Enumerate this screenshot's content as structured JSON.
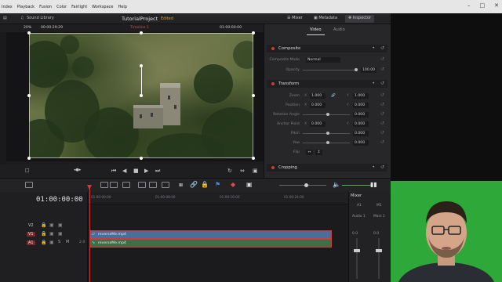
{
  "menubar": {
    "items": [
      "Index",
      "Playback",
      "Fusion",
      "Color",
      "Fairlight",
      "Workspace",
      "Help"
    ]
  },
  "toolbar": {
    "sound_library": "Sound Library",
    "project_title": "TutorialProject",
    "project_status": "Edited",
    "mixer": "Mixer",
    "metadata": "Metadata",
    "inspector": "Inspector"
  },
  "viewer": {
    "zoom": "20%",
    "timecode_left": "00:00:29:29",
    "timeline_name": "Timeline 1",
    "timecode_right": "01:00:00:00"
  },
  "inspector": {
    "tabs": {
      "video": "Video",
      "audio": "Audio"
    },
    "composite": {
      "title": "Composite",
      "mode_label": "Composite Mode",
      "mode_value": "Normal",
      "opacity_label": "Opacity",
      "opacity_value": "100.00"
    },
    "transform": {
      "title": "Transform",
      "zoom_label": "Zoom",
      "zoom_x": "1.000",
      "zoom_y": "1.000",
      "position_label": "Position",
      "position_x": "0.000",
      "position_y": "0.000",
      "rotation_label": "Rotation Angle",
      "rotation_value": "0.000",
      "anchor_label": "Anchor Point",
      "anchor_x": "0.000",
      "anchor_y": "0.000",
      "pitch_label": "Pitch",
      "pitch_value": "0.000",
      "yaw_label": "Yaw",
      "yaw_value": "0.000",
      "flip_label": "Flip",
      "x_axis": "X",
      "y_axis": "Y"
    },
    "cropping": {
      "title": "Cropping"
    }
  },
  "timeline": {
    "timecode": "01:00:00:00",
    "ruler": [
      "01:00:00:00",
      "01:00:08:00",
      "01:00:16:00",
      "01:00:24:00"
    ],
    "tracks": [
      {
        "name": "V2",
        "type": "video"
      },
      {
        "name": "V1",
        "type": "video"
      },
      {
        "name": "A1",
        "type": "audio",
        "level": "2.0"
      }
    ],
    "clips": {
      "video": "reverseMe.mp4",
      "audio": "reverseMe.mp4"
    }
  },
  "mixer": {
    "title": "Mixer",
    "channels": [
      "A1",
      "M1"
    ],
    "buses": [
      "Audio 1",
      "Main 1"
    ],
    "level": "0.0",
    "ch_a1": "A1",
    "ch_m1": "M1"
  },
  "colors": {
    "accent_red": "#d23a3a",
    "video_clip": "#4b6d9b",
    "audio_clip": "#3d6e46",
    "webcam_bg": "#2fa83a"
  }
}
